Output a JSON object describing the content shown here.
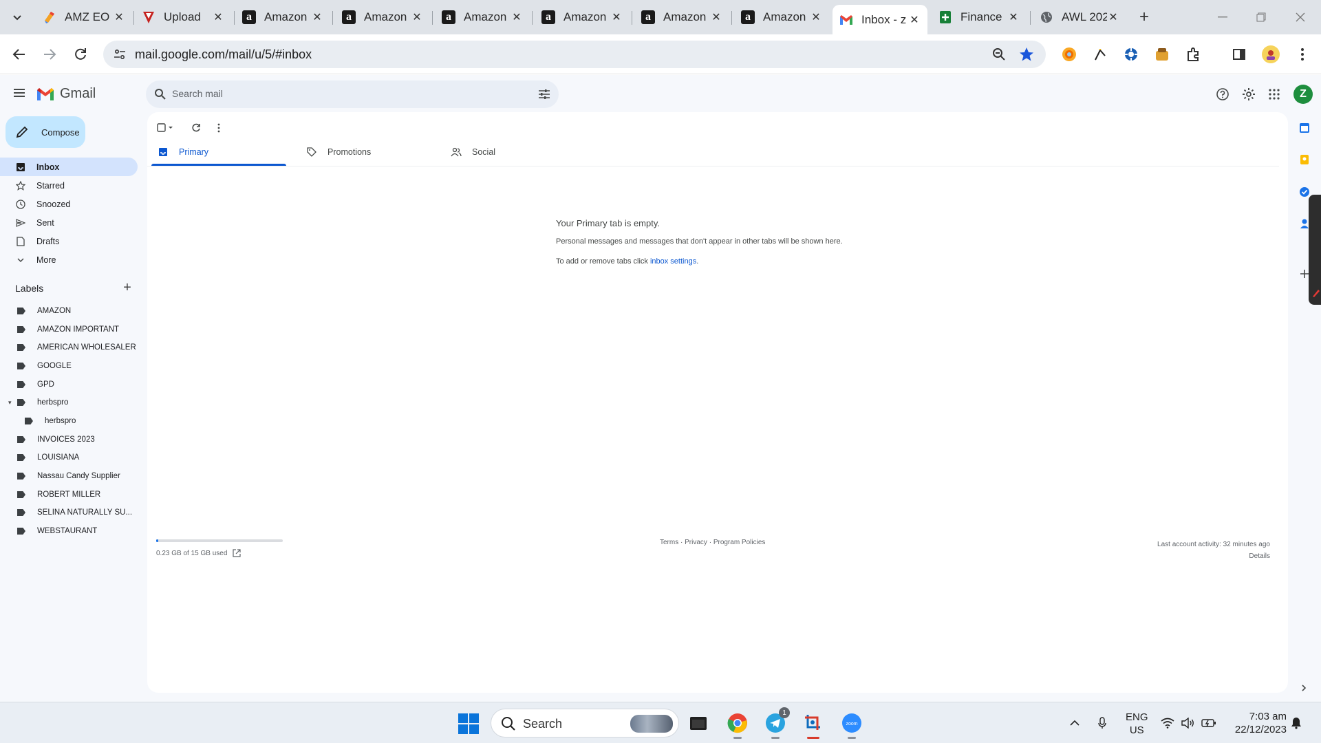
{
  "browser": {
    "tabs": [
      {
        "title": "AMZ EO",
        "favicon": "multicolor-doc-icon"
      },
      {
        "title": "Upload",
        "favicon": "red-shield-icon"
      },
      {
        "title": "Amazon",
        "favicon": "amazon-icon"
      },
      {
        "title": "Amazon",
        "favicon": "amazon-icon"
      },
      {
        "title": "Amazon",
        "favicon": "amazon-icon"
      },
      {
        "title": "Amazon",
        "favicon": "amazon-icon"
      },
      {
        "title": "Amazon",
        "favicon": "amazon-icon"
      },
      {
        "title": "Amazon",
        "favicon": "amazon-icon"
      },
      {
        "title": "Inbox - z",
        "favicon": "gmail-icon",
        "active": true
      },
      {
        "title": "Finance",
        "favicon": "sheets-icon"
      },
      {
        "title": "AWL 202",
        "favicon": "globe-icon"
      }
    ],
    "new_tab_label": "+",
    "url": "mail.google.com/mail/u/5/#inbox",
    "amazon_glyph": "a"
  },
  "gmail": {
    "product_name": "Gmail",
    "search_placeholder": "Search mail",
    "avatar_initial": "Z",
    "compose_label": "Compose",
    "nav": [
      {
        "label": "Inbox",
        "icon": "inbox-icon",
        "active": true
      },
      {
        "label": "Starred",
        "icon": "star-icon"
      },
      {
        "label": "Snoozed",
        "icon": "clock-icon"
      },
      {
        "label": "Sent",
        "icon": "send-icon"
      },
      {
        "label": "Drafts",
        "icon": "draft-icon"
      },
      {
        "label": "More",
        "icon": "chevron-down-icon"
      }
    ],
    "labels_title": "Labels",
    "labels": [
      "AMAZON",
      "AMAZON IMPORTANT",
      "AMERICAN WHOLESALER",
      "GOOGLE",
      "GPD",
      "herbspro",
      "herbspro",
      "INVOICES 2023",
      "LOUISIANA",
      "Nassau Candy Supplier",
      "ROBERT MILLER",
      "SELINA NATURALLY SU...",
      "WEBSTAURANT"
    ],
    "category_tabs": [
      {
        "label": "Primary",
        "icon": "inbox-tab-icon",
        "active": true
      },
      {
        "label": "Promotions",
        "icon": "tag-icon"
      },
      {
        "label": "Social",
        "icon": "people-icon"
      }
    ],
    "empty_state": {
      "title": "Your Primary tab is empty.",
      "description": "Personal messages and messages that don't appear in other tabs will be shown here.",
      "settings_prefix": "To add or remove tabs click ",
      "settings_link": "inbox settings",
      "settings_suffix": "."
    },
    "footer": {
      "storage_text": "0.23 GB of 15 GB used",
      "storage_fraction": 0.015,
      "terms": "Terms",
      "privacy": "Privacy",
      "policies": "Program Policies",
      "separator": " · ",
      "activity": "Last account activity: 32 minutes ago",
      "details": "Details"
    }
  },
  "taskbar": {
    "search_label": "Search",
    "telegram_badge": "1",
    "lang_line1": "ENG",
    "lang_line2": "US",
    "time": "7:03 am",
    "date": "22/12/2023"
  }
}
